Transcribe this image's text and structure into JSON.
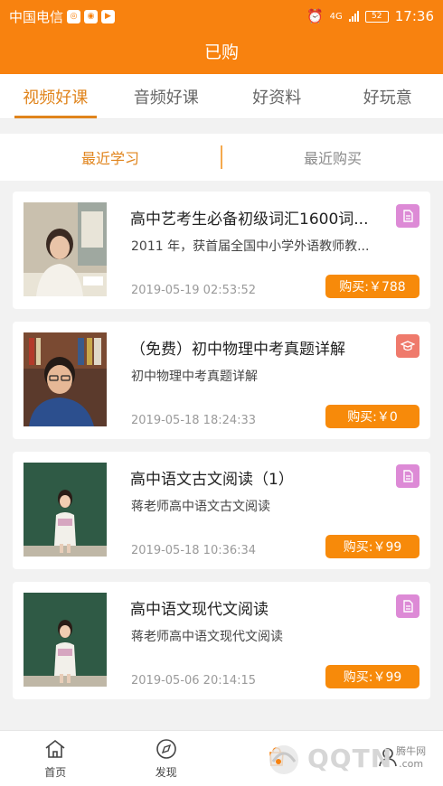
{
  "status_bar": {
    "carrier": "中国电信",
    "net": "4G",
    "battery": "52",
    "time": "17:36"
  },
  "header": {
    "title": "已购"
  },
  "tabs": [
    {
      "label": "视频好课",
      "active": true
    },
    {
      "label": "音频好课",
      "active": false
    },
    {
      "label": "好资料",
      "active": false
    },
    {
      "label": "好玩意",
      "active": false
    }
  ],
  "subtabs": [
    {
      "label": "最近学习",
      "active": true
    },
    {
      "label": "最近购买",
      "active": false
    }
  ],
  "purchases": [
    {
      "title": "高中艺考生必备初级词汇1600词...",
      "desc": "2011 年，获首届全国中小学外语教师教...",
      "date": "2019-05-19 02:53:52",
      "price": "购买:￥788",
      "badge_icon": "document-icon"
    },
    {
      "title": "（免费）初中物理中考真题详解",
      "desc": "初中物理中考真题详解",
      "date": "2019-05-18 18:24:33",
      "price": "购买:￥0",
      "badge_icon": "graduation-cap-icon"
    },
    {
      "title": "高中语文古文阅读（1）",
      "desc": "蒋老师高中语文古文阅读",
      "date": "2019-05-18 10:36:34",
      "price": "购买:￥99",
      "badge_icon": "document-icon"
    },
    {
      "title": "高中语文现代文阅读",
      "desc": "蒋老师高中语文现代文阅读",
      "date": "2019-05-06 20:14:15",
      "price": "购买:￥99",
      "badge_icon": "document-icon"
    }
  ],
  "bottom_nav": [
    {
      "label": "首页",
      "icon": "home-icon"
    },
    {
      "label": "发现",
      "icon": "discover-icon"
    },
    {
      "label": "",
      "icon": "purchased-icon"
    },
    {
      "label": "",
      "icon": "profile-icon"
    }
  ],
  "watermark": {
    "text": "QQTN",
    "site": "腾牛网",
    "domain": ".com"
  },
  "colors": {
    "accent": "#f8820f",
    "active_text": "#e0841c",
    "price_button": "#f78a0a",
    "doc_badge": "#dd8ad6",
    "course_badge": "#ef7a6c"
  }
}
